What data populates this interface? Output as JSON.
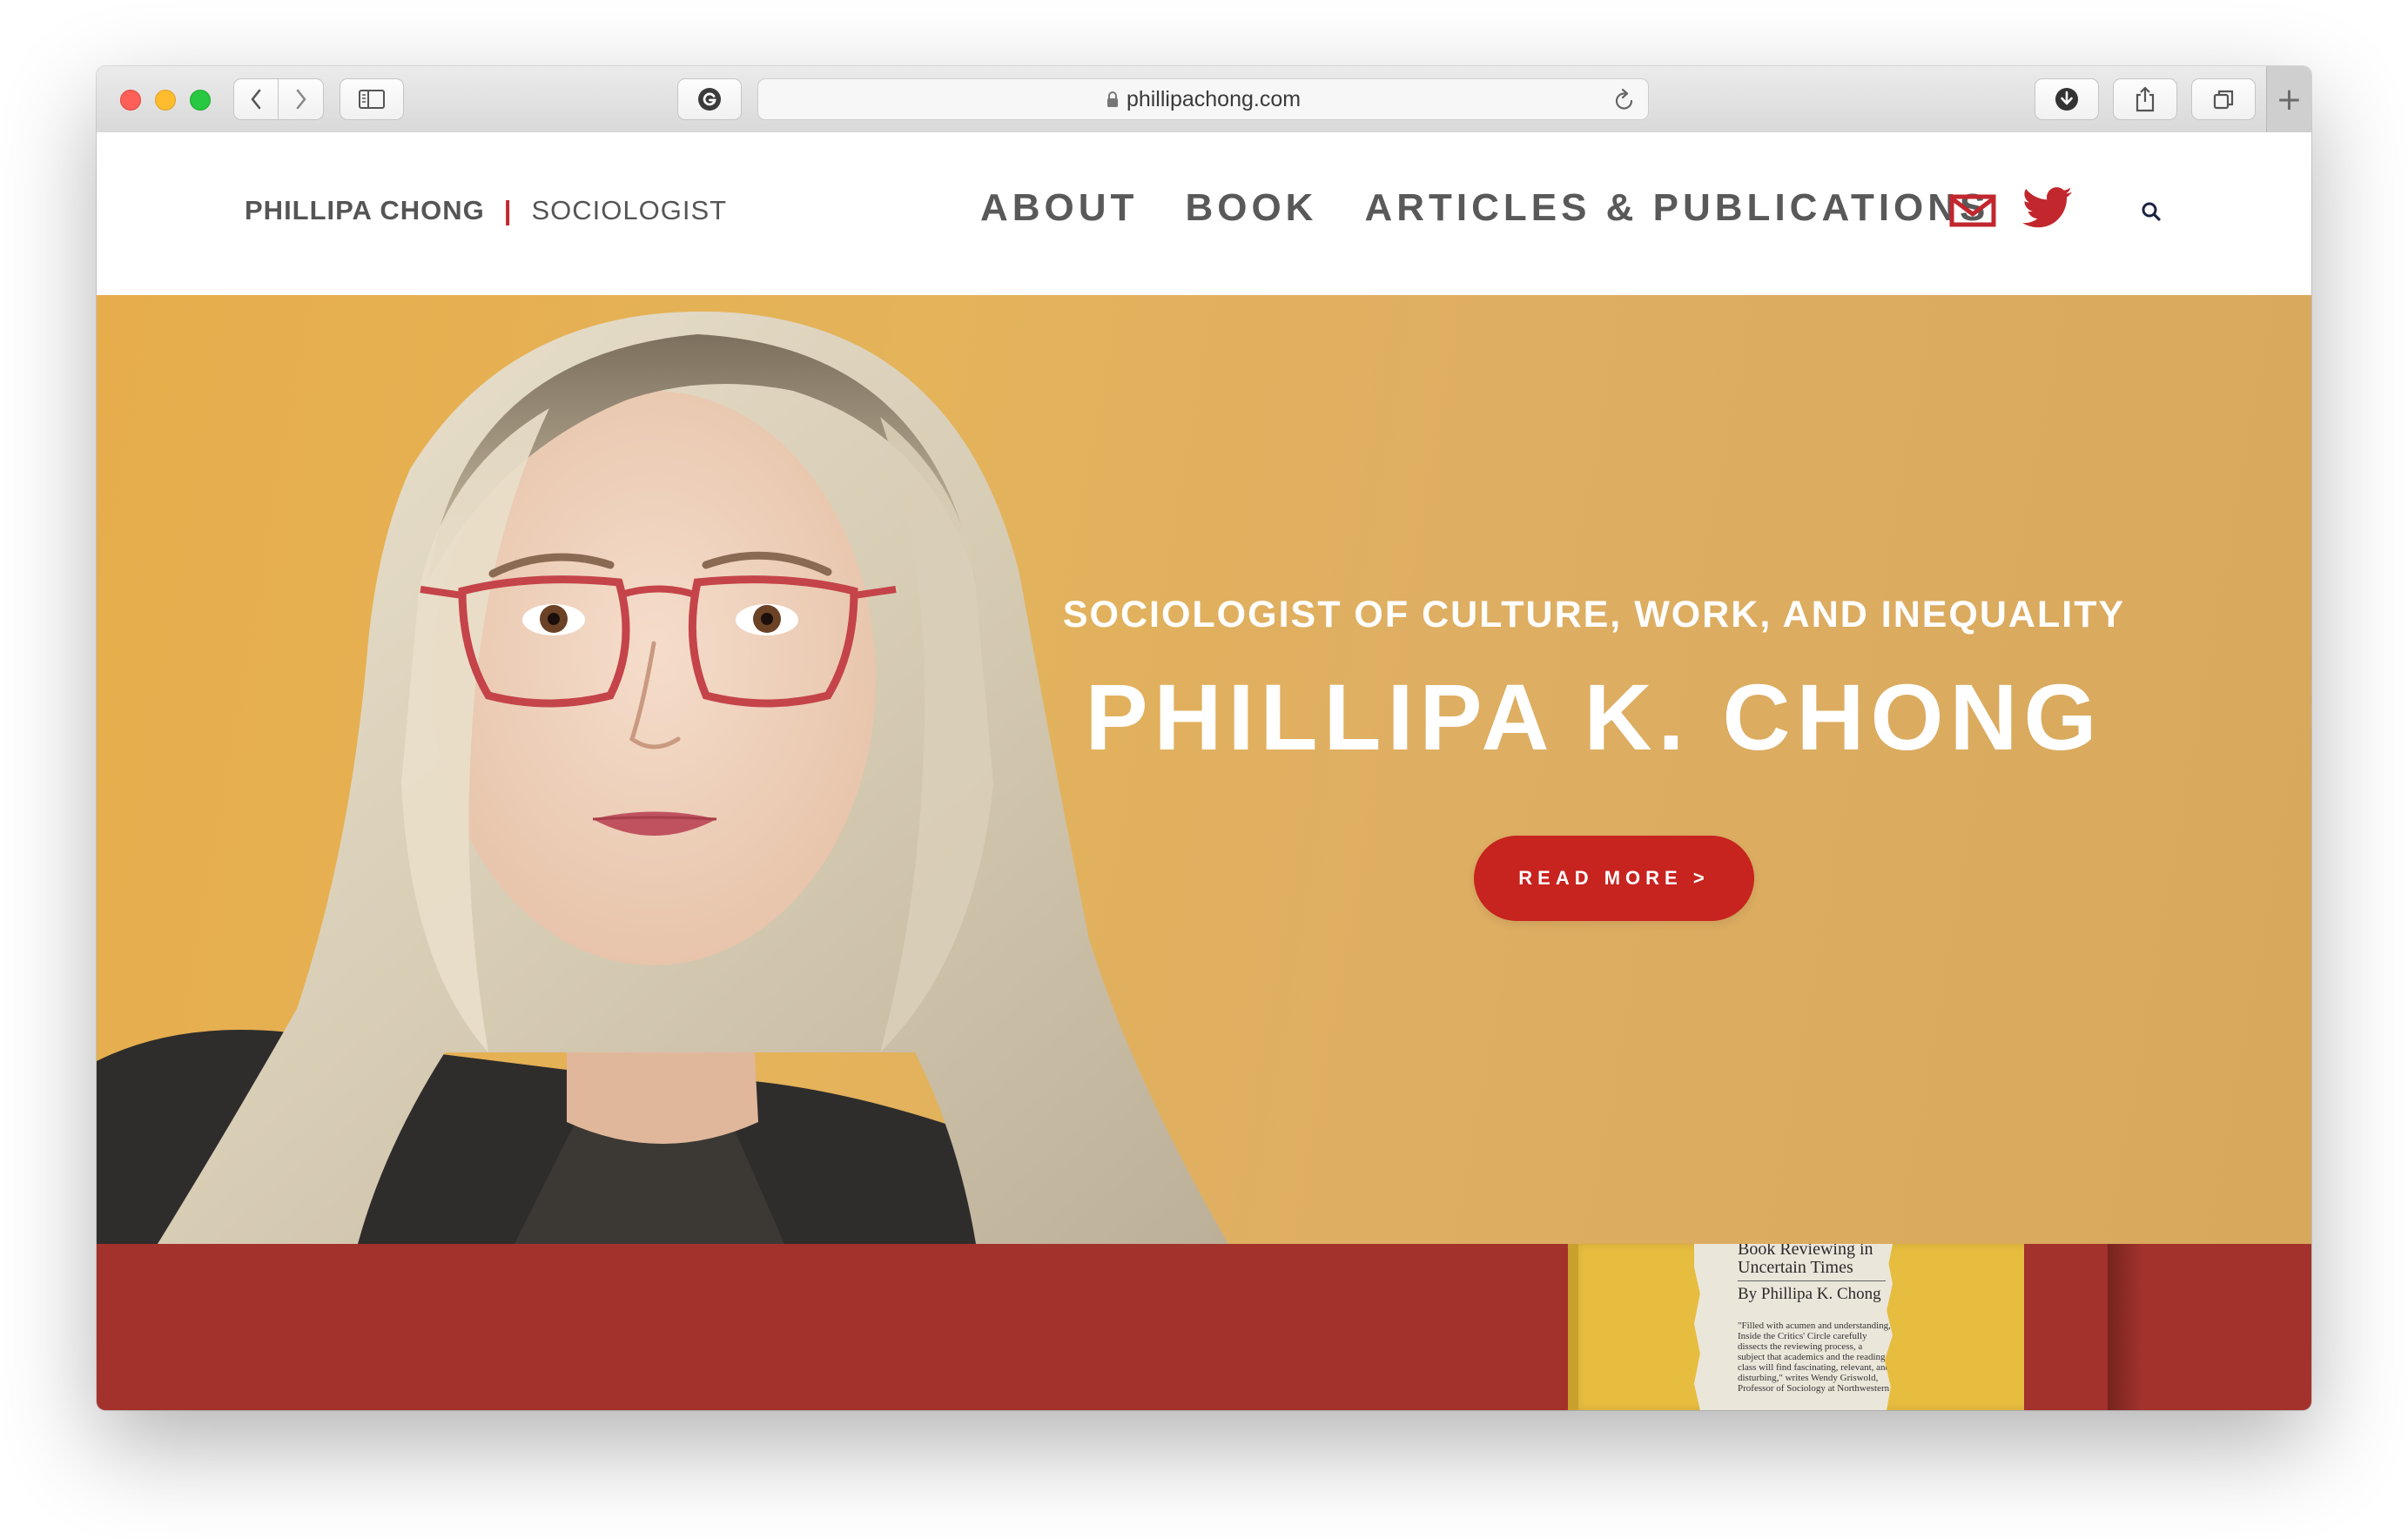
{
  "browser": {
    "url": "phillipachong.com",
    "new_tab_label": "+"
  },
  "site": {
    "brand_name": "PHILLIPA CHONG",
    "brand_separator": "|",
    "brand_role": "SOCIOLOGIST",
    "nav": [
      {
        "label": "ABOUT"
      },
      {
        "label": "BOOK"
      },
      {
        "label": "ARTICLES & PUBLICATIONS"
      }
    ],
    "icons": [
      "mail-icon",
      "twitter-icon",
      "search-icon"
    ]
  },
  "hero": {
    "subtitle": "SOCIOLOGIST OF CULTURE, WORK, AND INEQUALITY",
    "title": "PHILLIPA K. CHONG",
    "cta_label": "READ MORE >"
  },
  "book_clipping": {
    "headline": "Book Reviewing in Uncertain Times",
    "byline": "By Phillipa K. Chong",
    "blurb": "\"Filled with acumen and understanding, Inside the Critics' Circle carefully dissects the reviewing process, a subject that academics and the reading class will find fascinating, relevant, and disturbing,\" writes Wendy Griswold, Professor of Sociology at Northwestern"
  },
  "colors": {
    "accent_red": "#c7231f",
    "band_red": "#a3322c",
    "hero_gold": "#e4b35a",
    "nav_gray": "#595959"
  }
}
